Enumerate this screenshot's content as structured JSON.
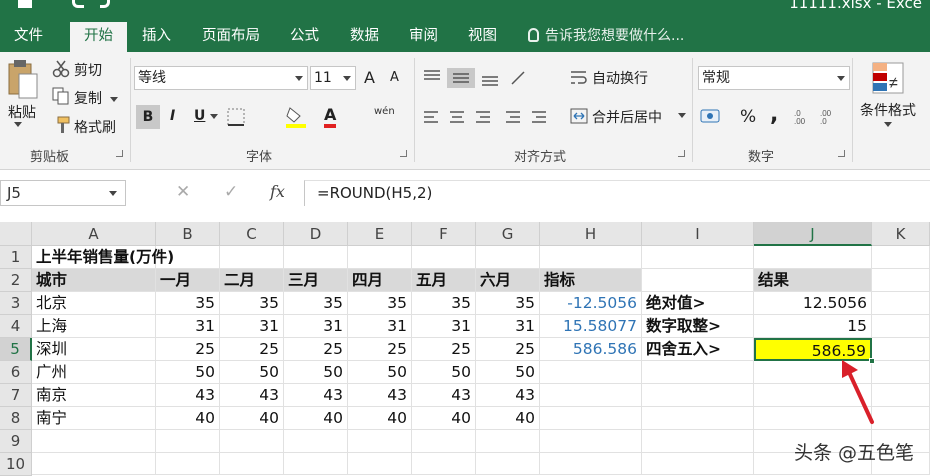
{
  "window": {
    "title": "11111.xlsx - Exce"
  },
  "tabs": [
    {
      "label": "文件"
    },
    {
      "label": "开始"
    },
    {
      "label": "插入"
    },
    {
      "label": "页面布局"
    },
    {
      "label": "公式"
    },
    {
      "label": "数据"
    },
    {
      "label": "审阅"
    },
    {
      "label": "视图"
    }
  ],
  "tellme": {
    "label": "告诉我您想要做什么..."
  },
  "ribbon": {
    "clipboard": {
      "paste": "粘贴",
      "cut": "剪切",
      "copy": "复制",
      "format_painter": "格式刷",
      "group": "剪贴板"
    },
    "font": {
      "name": "等线",
      "size": "11",
      "grow": "A",
      "shrink": "A",
      "bold": "B",
      "italic": "I",
      "underline": "U",
      "font_color_glyph": "A",
      "phonetic": "wén",
      "group": "字体"
    },
    "alignment": {
      "wrap": "自动换行",
      "merge": "合并后居中",
      "group": "对齐方式"
    },
    "number": {
      "format": "常规",
      "percent": "%",
      "comma": ",",
      "group": "数字"
    },
    "styles": {
      "conditional": "条件格式"
    }
  },
  "formula_bar": {
    "name_box": "J5",
    "cancel": "✕",
    "enter": "✓",
    "fx": "fx",
    "formula": "=ROUND(H5,2)"
  },
  "columns": [
    "A",
    "B",
    "C",
    "D",
    "E",
    "F",
    "G",
    "H",
    "I",
    "J",
    "K"
  ],
  "rows": [
    "1",
    "2",
    "3",
    "4",
    "5",
    "6",
    "7",
    "8",
    "9",
    "10"
  ],
  "sheet": {
    "title": "上半年销售量(万件)",
    "headers": [
      "城市",
      "一月",
      "二月",
      "三月",
      "四月",
      "五月",
      "六月",
      "指标",
      "",
      "结果"
    ],
    "data": [
      {
        "city": "北京",
        "values": [
          "35",
          "35",
          "35",
          "35",
          "35",
          "35"
        ],
        "metric": "-12.5056",
        "label": "绝对值>",
        "result": "12.5056"
      },
      {
        "city": "上海",
        "values": [
          "31",
          "31",
          "31",
          "31",
          "31",
          "31"
        ],
        "metric": "15.58077",
        "label": "数字取整>",
        "result": "15"
      },
      {
        "city": "深圳",
        "values": [
          "25",
          "25",
          "25",
          "25",
          "25",
          "25"
        ],
        "metric": "586.586",
        "label": "四舍五入>",
        "result": "586.59"
      },
      {
        "city": "广州",
        "values": [
          "50",
          "50",
          "50",
          "50",
          "50",
          "50"
        ],
        "metric": "",
        "label": "",
        "result": ""
      },
      {
        "city": "南京",
        "values": [
          "43",
          "43",
          "43",
          "43",
          "43",
          "43"
        ],
        "metric": "",
        "label": "",
        "result": ""
      },
      {
        "city": "南宁",
        "values": [
          "40",
          "40",
          "40",
          "40",
          "40",
          "40"
        ],
        "metric": "",
        "label": "",
        "result": ""
      }
    ]
  },
  "watermark": "头条 @五色笔",
  "colors": {
    "excel_green": "#217346",
    "highlight": "#ffff00",
    "metric_blue": "#2f74b5",
    "arrow_red": "#d9202a"
  }
}
